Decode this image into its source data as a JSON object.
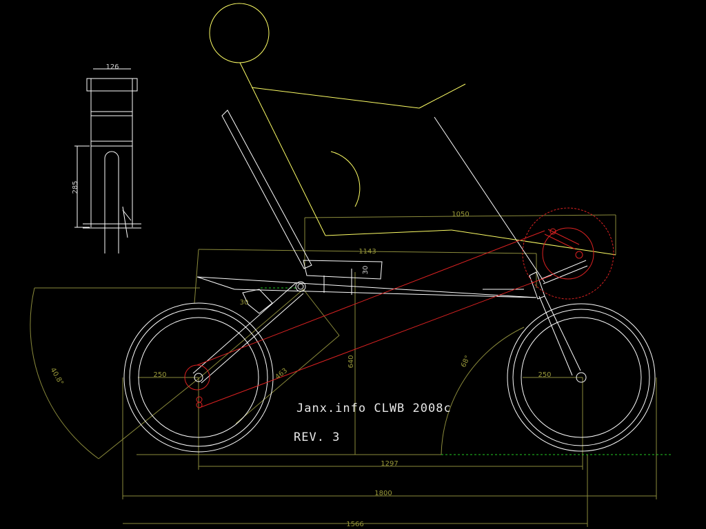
{
  "colors": {
    "background": "#000000",
    "frame": "#ffffff",
    "dimension": "#8c8c3c",
    "rider": "#ffff66",
    "chain": "#dd2222",
    "ground_ref": "#22cc22"
  },
  "title": "Janx.info CLWB 2008c",
  "revision": "REV. 3",
  "dimensions": {
    "overall_length": "1800",
    "lower_length": "1566",
    "wheelbase": "1297",
    "seat_length": "1143",
    "rider_span": "1050",
    "crank_height": "640",
    "boom_length": "463",
    "rear_radius": "250",
    "front_radius": "250",
    "rear_angle": "40.8°",
    "front_angle": "68°",
    "seat_angle": "30",
    "seat_detail": "30",
    "fork_width": "126",
    "fork_height": "285"
  }
}
